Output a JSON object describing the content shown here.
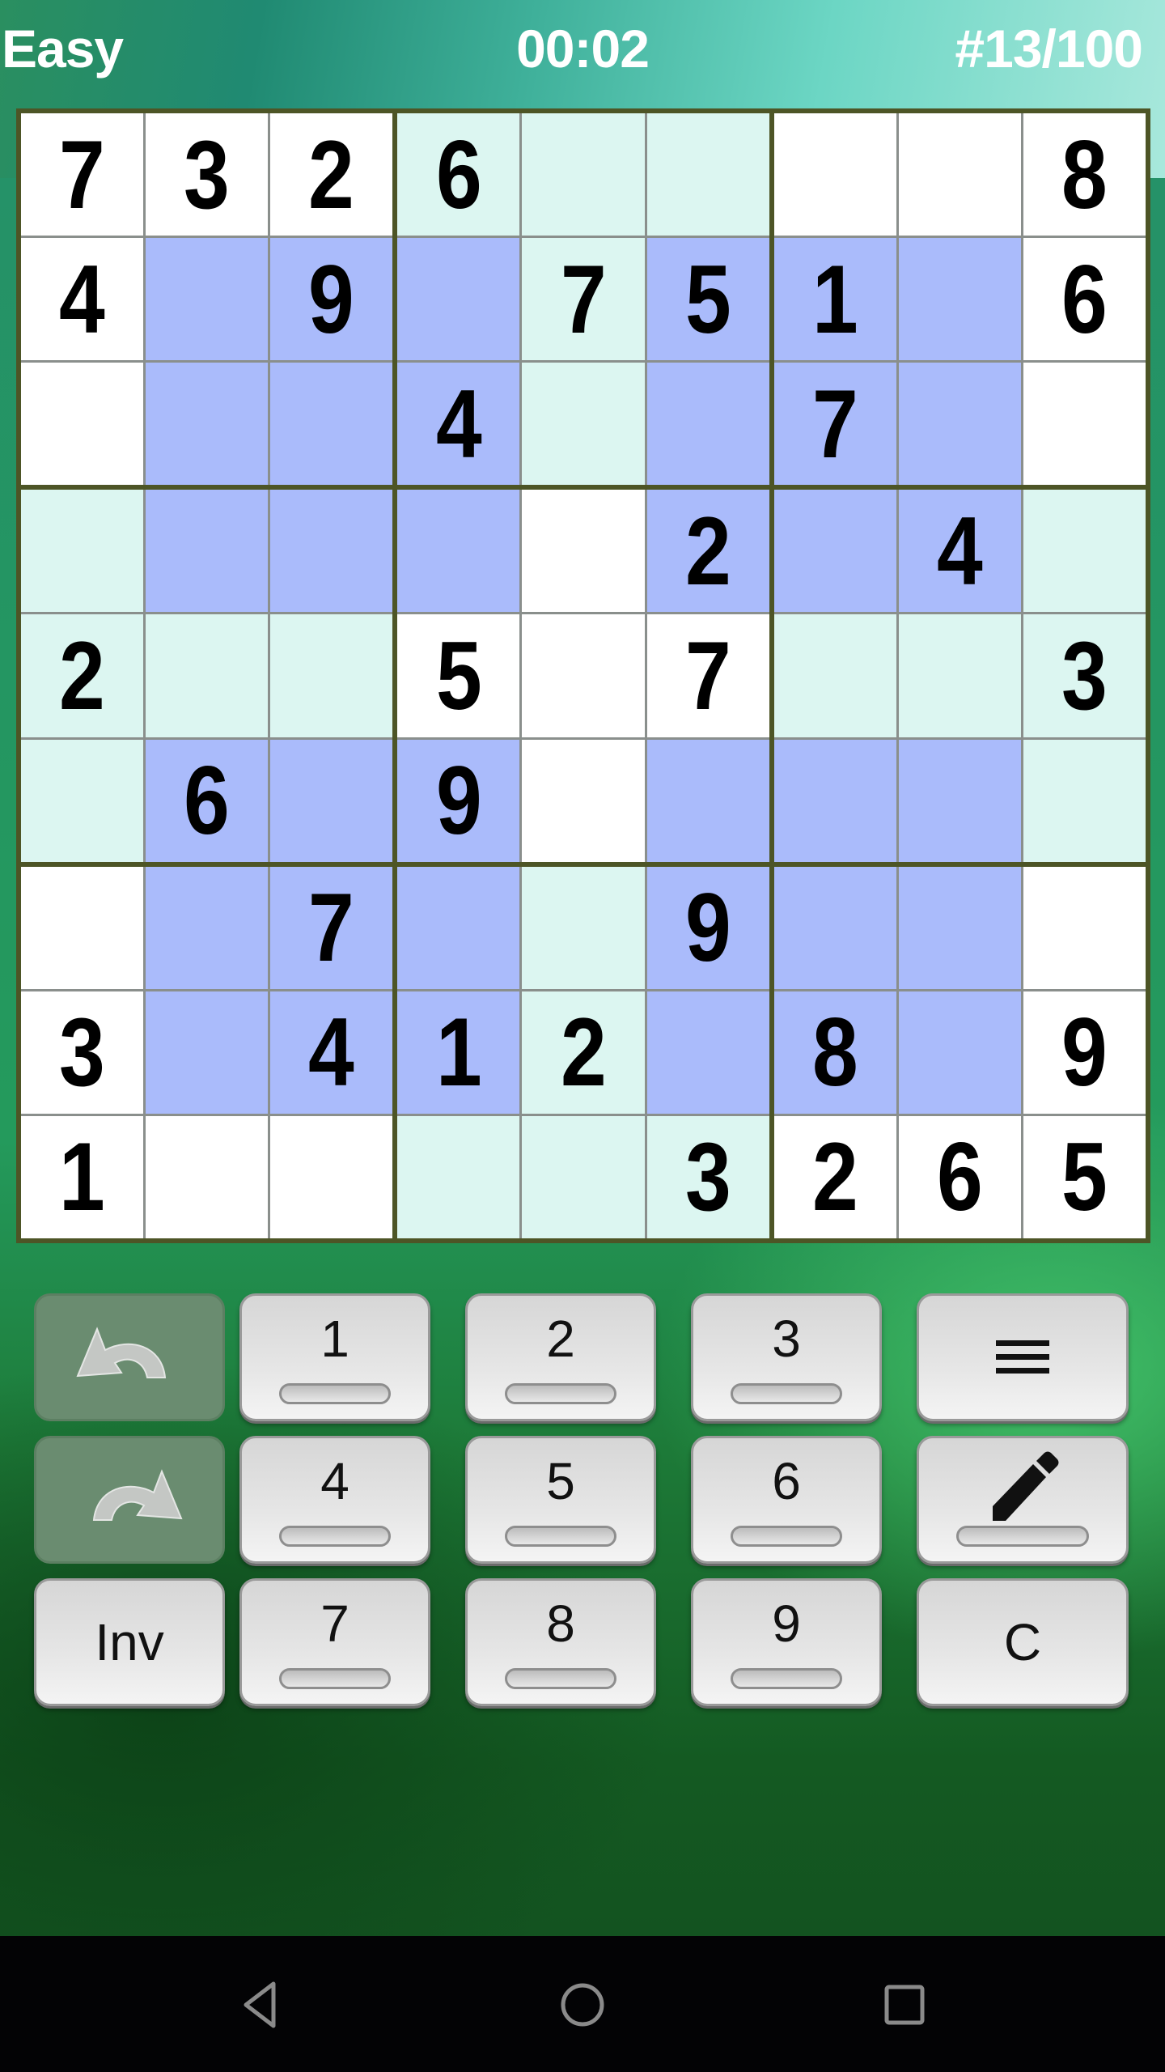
{
  "header": {
    "difficulty": "Easy",
    "timer": "00:02",
    "puzzle_number": "#13/100"
  },
  "board": {
    "rows": [
      [
        "7",
        "3",
        "2",
        "6",
        "",
        "",
        "",
        "",
        "8"
      ],
      [
        "4",
        "",
        "9",
        "",
        "7",
        "5",
        "1",
        "",
        "6"
      ],
      [
        "",
        "",
        "",
        "4",
        "",
        "",
        "7",
        "",
        ""
      ],
      [
        "",
        "",
        "",
        "",
        "",
        "2",
        "",
        "4",
        ""
      ],
      [
        "2",
        "",
        "",
        "5",
        "",
        "7",
        "",
        "",
        "3"
      ],
      [
        "",
        "6",
        "",
        "9",
        "",
        "",
        "",
        "",
        ""
      ],
      [
        "",
        "",
        "7",
        "",
        "",
        "9",
        "",
        "",
        ""
      ],
      [
        "3",
        "",
        "4",
        "1",
        "2",
        "",
        "8",
        "",
        "9"
      ],
      [
        "1",
        "",
        "",
        "",
        "",
        "3",
        "2",
        "6",
        "5"
      ]
    ],
    "shading": [
      "WWWLLLWWW",
      "WBBBLBBBW",
      "WBBBLBBBW",
      "LBBBWBBBL",
      "LLLWWWLLL",
      "LBBBWBBBL",
      "WBBBLBBBW",
      "WBBBLBBBW",
      "WWWLLLWWW"
    ],
    "colors": {
      "white": "#ffffff",
      "light": "#dcf6f1",
      "highlight": "#aabbfb",
      "thick_line": "#4d5526",
      "thin_line": "#8a8f8c"
    }
  },
  "keypad": {
    "undo": {
      "icon": "undo-arrow-icon",
      "enabled": false
    },
    "redo": {
      "icon": "redo-arrow-icon",
      "enabled": false
    },
    "invert_label": "Inv",
    "digits": [
      "1",
      "2",
      "3",
      "4",
      "5",
      "6",
      "7",
      "8",
      "9"
    ],
    "menu_icon": "hamburger-menu-icon",
    "pencil_icon": "pencil-icon",
    "clear_label": "C"
  },
  "navbar": {
    "back_icon": "back-triangle-icon",
    "home_icon": "home-circle-icon",
    "recents_icon": "recents-square-icon"
  }
}
